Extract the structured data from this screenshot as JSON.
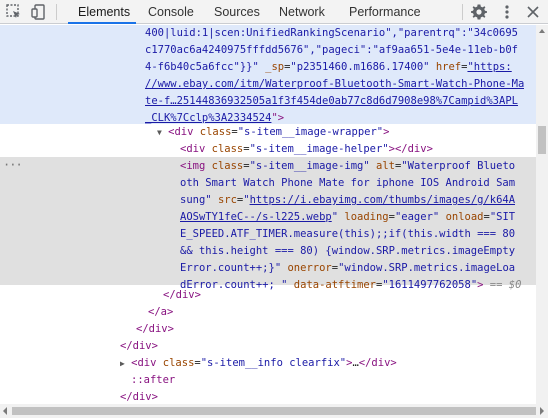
{
  "toolbar": {
    "tabs": [
      "Elements",
      "Console",
      "Sources",
      "Network",
      "Performance"
    ],
    "active_tab": "Elements",
    "icons": [
      "inspect-element-icon",
      "device-toolbar-icon",
      "settings-gear-icon",
      "more-options-icon",
      "close-icon"
    ]
  },
  "colors": {
    "tag": "#881280",
    "attr_name": "#994500",
    "attr_value": "#1a1aa6",
    "selection_bg": "#dfe9fa",
    "hover_bg": "#e0e0e0",
    "active_tab_underline": "#1a73e8"
  },
  "code": {
    "l1": "400|luid:1|scen:UnifiedRankingScenario\",\"parentrq\":\"34c0695",
    "l2": "c1770ac6a4240975fffdd5676\",\"pageci\":\"af9aa651-5e4e-11eb-b0f",
    "l3": "4-f6b40c5a6fcc\"}}\"",
    "l3_sp_name": "_sp",
    "l3_sp_val": "\"p2351460.m1686.17400\"",
    "l3_href_name": "href",
    "l3_href_start": "\"https:",
    "l4": "//www.ebay.com/itm/Waterproof-Bluetooth-Smart-Watch-Phone-Ma",
    "l5": "te-f…25144836932505a1f3f454de0ab77c8d6d7908e98%7Campid%3APL",
    "l6": "_CLK%7Cclp%3A2334524",
    "l6_end": "\">",
    "div_open": "<div",
    "class_attr": "class",
    "wrapper_class": "\"s-item__image-wrapper\"",
    "helper_class": "\"s-item__image-helper\"",
    "img_open": "<img",
    "img_class": "\"s-item__image-img\"",
    "alt_attr": "alt",
    "alt_val_1": "\"Waterproof Blueto",
    "alt_val_2": "oth Smart Watch Phone Mate for iphone IOS Android Sam",
    "alt_val_3": "sung\"",
    "src_attr": "src",
    "src_q": "\"",
    "src_link_1": "https://i.ebayimg.com/thumbs/images/g/k64A",
    "src_link_2": "AOSwTY1feC--/s-l225.webp",
    "loading_attr": "loading",
    "loading_val": "\"eager\"",
    "onload_attr": "onload",
    "onload_1": "\"SIT",
    "onload_2": "E_SPEED.ATF_TIMER.measure(this);;if(this.width === 80",
    "onload_3": "&& this.height === 80) {window.SRP.metrics.imageEmpty",
    "onload_4": "Error.count++;}\"",
    "onerror_attr": "onerror",
    "onerror_1": "\"window.SRP.metrics.imageLoa",
    "onerror_2": "dError.count++; \"",
    "atf_attr": "data-atftimer",
    "atf_val": "\"1611497762058\"",
    "eq_sign": "== $0",
    "close_div": "</div>",
    "close_a": "</a>",
    "info_class": "\"s-item__info clearfix\"",
    "ellipsis": "…",
    "after": "::after",
    "gt": ">",
    "eq": "="
  }
}
